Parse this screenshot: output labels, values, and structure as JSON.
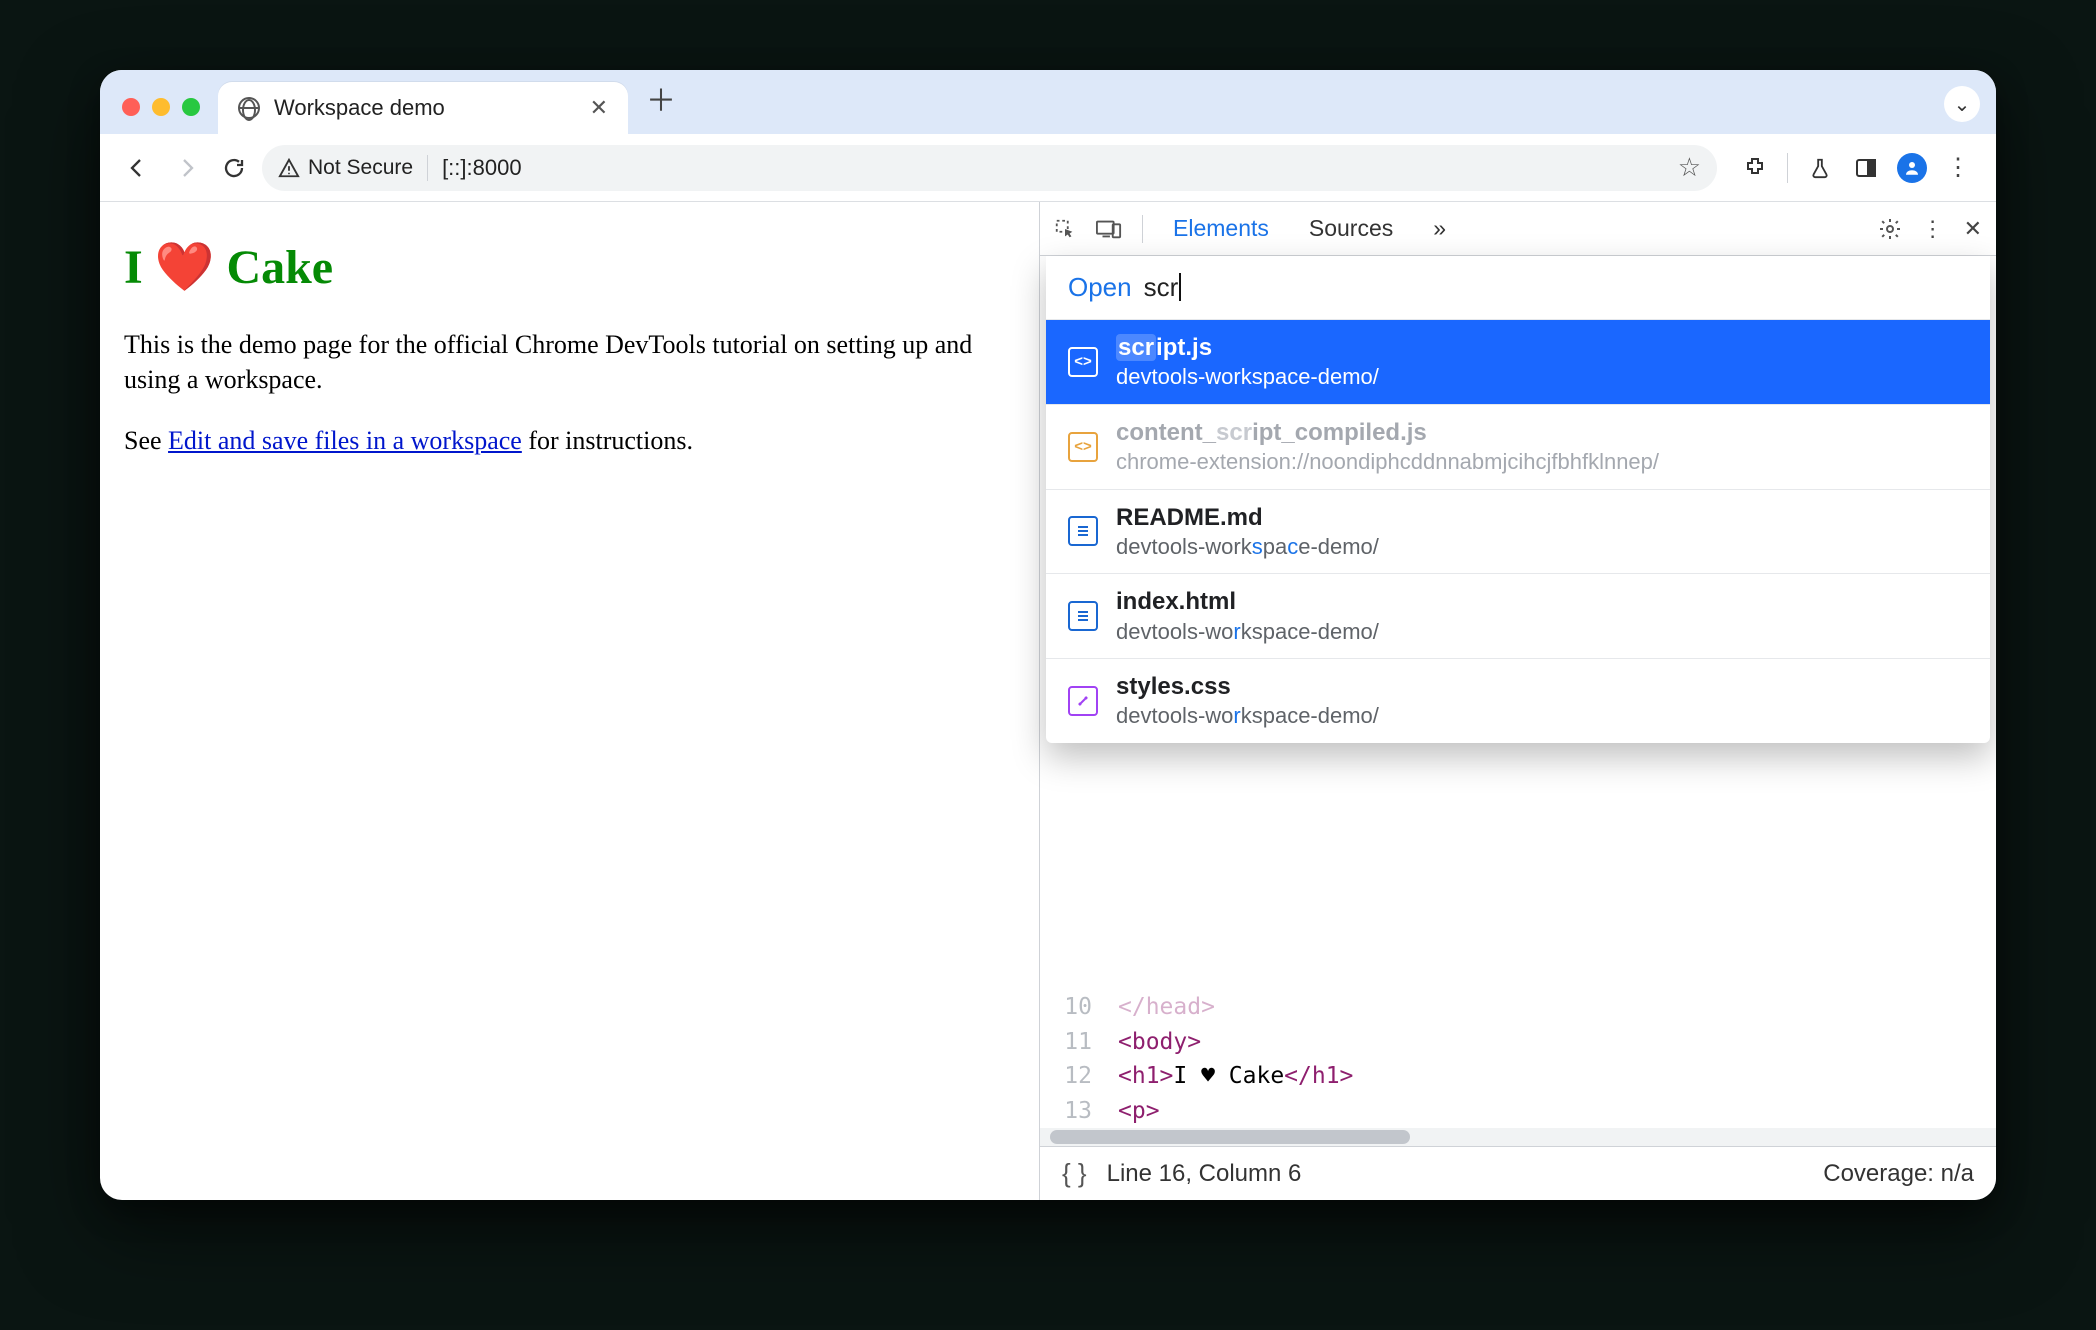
{
  "window": {
    "tab_title": "Workspace demo"
  },
  "toolbar": {
    "security_label": "Not Secure",
    "url": "[::]:8000"
  },
  "page": {
    "heading": "I ❤️ Cake",
    "para": "This is the demo page for the official Chrome DevTools tutorial on setting up and using a workspace.",
    "see_prefix": "See ",
    "link_text": "Edit and save files in a workspace",
    "see_suffix": " for instructions."
  },
  "devtools": {
    "tabs": {
      "elements": "Elements",
      "sources": "Sources",
      "more": "»"
    },
    "open_label": "Open",
    "open_query": "scr",
    "results": [
      {
        "name_hl": "scr",
        "name_rest": "ipt.js",
        "path": "devtools-workspace-demo/",
        "icon": "script",
        "selected": true
      },
      {
        "name_pre": "content_",
        "name_hl": "scr",
        "name_rest": "ipt_compiled.js",
        "path": "chrome-extension://noondiphcddnnabmjcihcjfbhfklnnep/",
        "icon": "script-dim",
        "dim": true
      },
      {
        "name": "README.md",
        "path_a": "devtools-work",
        "path_hl1": "s",
        "path_b": "pa",
        "path_hl2": "c",
        "path_c": "e-demo/",
        "icon": "doc"
      },
      {
        "name": "index.html",
        "path_a": "devtools-wo",
        "path_hl1": "r",
        "path_b": "kspace-demo/",
        "icon": "doc"
      },
      {
        "name": "styles.css",
        "path_a": "devtools-wo",
        "path_hl1": "r",
        "path_b": "kspace-demo/",
        "icon": "style"
      }
    ],
    "code": {
      "l10_num": "10",
      "l10": "</head>",
      "l11_num": "11",
      "l11": "<body>",
      "l12_num": "12",
      "l12_pre": "  <h1>",
      "l12_txt": "I ♥ Cake",
      "l12_post": "</h1>",
      "l13_num": "13",
      "l13": "  <p>"
    },
    "status": {
      "cursor": "Line 16, Column 6",
      "coverage": "Coverage: n/a"
    }
  }
}
